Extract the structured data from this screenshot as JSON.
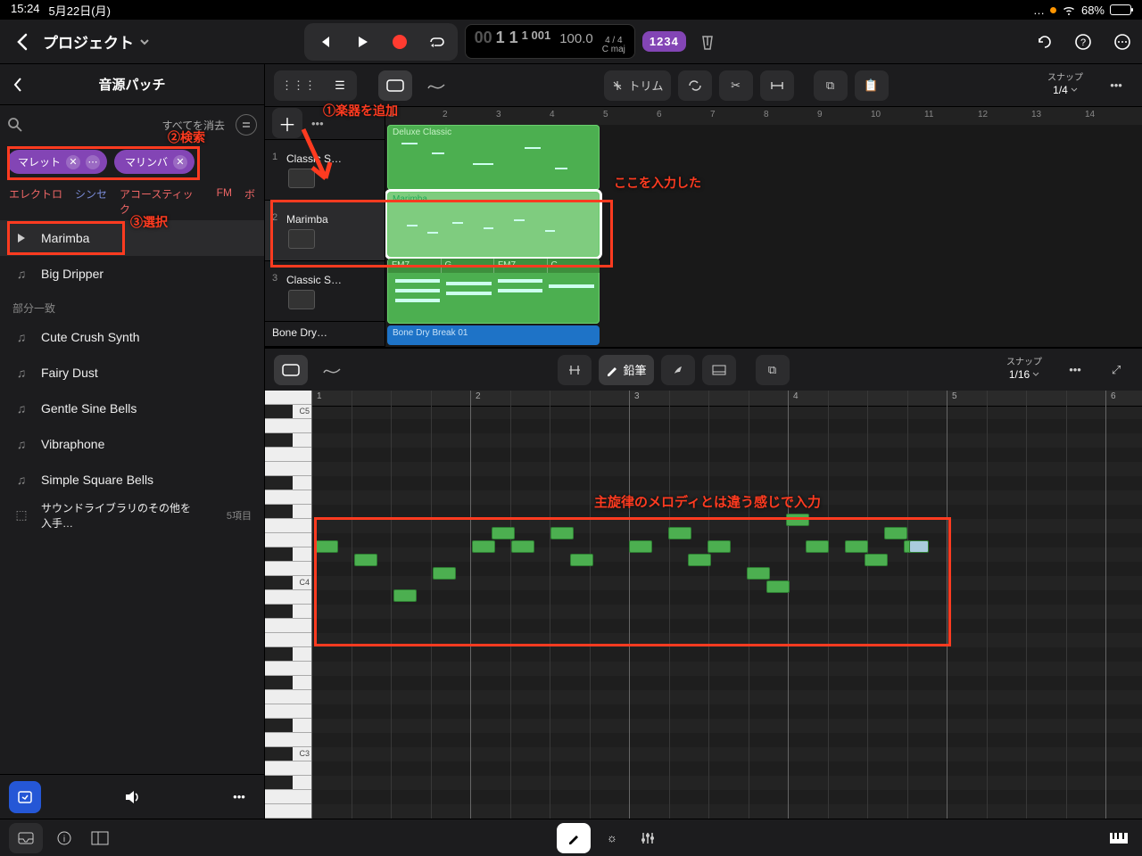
{
  "status": {
    "time": "15:24",
    "date": "5月22日(月)",
    "battery": "68%"
  },
  "header": {
    "project": "プロジェクト",
    "lcd": {
      "pos_small": "00",
      "pos1": "1 1",
      "pos2": "1 001",
      "tempo": "100.0",
      "sig": "4 / 4",
      "key": "C maj"
    },
    "beat_badge": "1234"
  },
  "sidebar": {
    "title": "音源パッチ",
    "clear_all": "すべてを消去",
    "tags": [
      {
        "label": "マレット"
      },
      {
        "label": "マリンバ"
      }
    ],
    "cats": [
      "エレクトロ",
      "シンセ",
      "アコースティック",
      "FM",
      "ボ"
    ],
    "items_top": [
      "Marimba",
      "Big Dripper"
    ],
    "section": "部分一致",
    "items_bottom": [
      "Cute Crush Synth",
      "Fairy Dust",
      "Gentle Sine Bells",
      "Vibraphone",
      "Simple Square Bells"
    ],
    "store": "サウンドライブラリのその他を入手…",
    "store_count": "5項目"
  },
  "arrange_toolbar": {
    "trim": "トリム",
    "snap_label": "スナップ",
    "snap_val": "1/4"
  },
  "tracks": [
    {
      "num": "1",
      "name": "Classic S…",
      "region": "Deluxe Classic"
    },
    {
      "num": "2",
      "name": "Marimba",
      "region": "Marimba"
    },
    {
      "num": "3",
      "name": "Classic S…",
      "chords": [
        "FM7",
        "G",
        "FM7",
        "C"
      ]
    },
    {
      "num": "",
      "name": "Bone Dry…",
      "region": "Bone Dry Break 01"
    }
  ],
  "ruler": [
    "1",
    "2",
    "3",
    "4",
    "5",
    "6",
    "7",
    "8",
    "9",
    "10",
    "11",
    "12",
    "13",
    "14"
  ],
  "editor_toolbar": {
    "pencil": "鉛筆",
    "snap_label": "スナップ",
    "snap_val": "1/16"
  },
  "editor_ruler": [
    "1",
    "2",
    "3",
    "4",
    "5",
    "6"
  ],
  "piano_labels": {
    "c5": "C5",
    "c4": "C4",
    "c3": "C3"
  },
  "annotations": {
    "a1": "①楽器を追加",
    "a2": "②検索",
    "a3": "③選択",
    "a4": "ここを入力した",
    "a5": "主旋律のメロディとは違う感じで入力"
  }
}
